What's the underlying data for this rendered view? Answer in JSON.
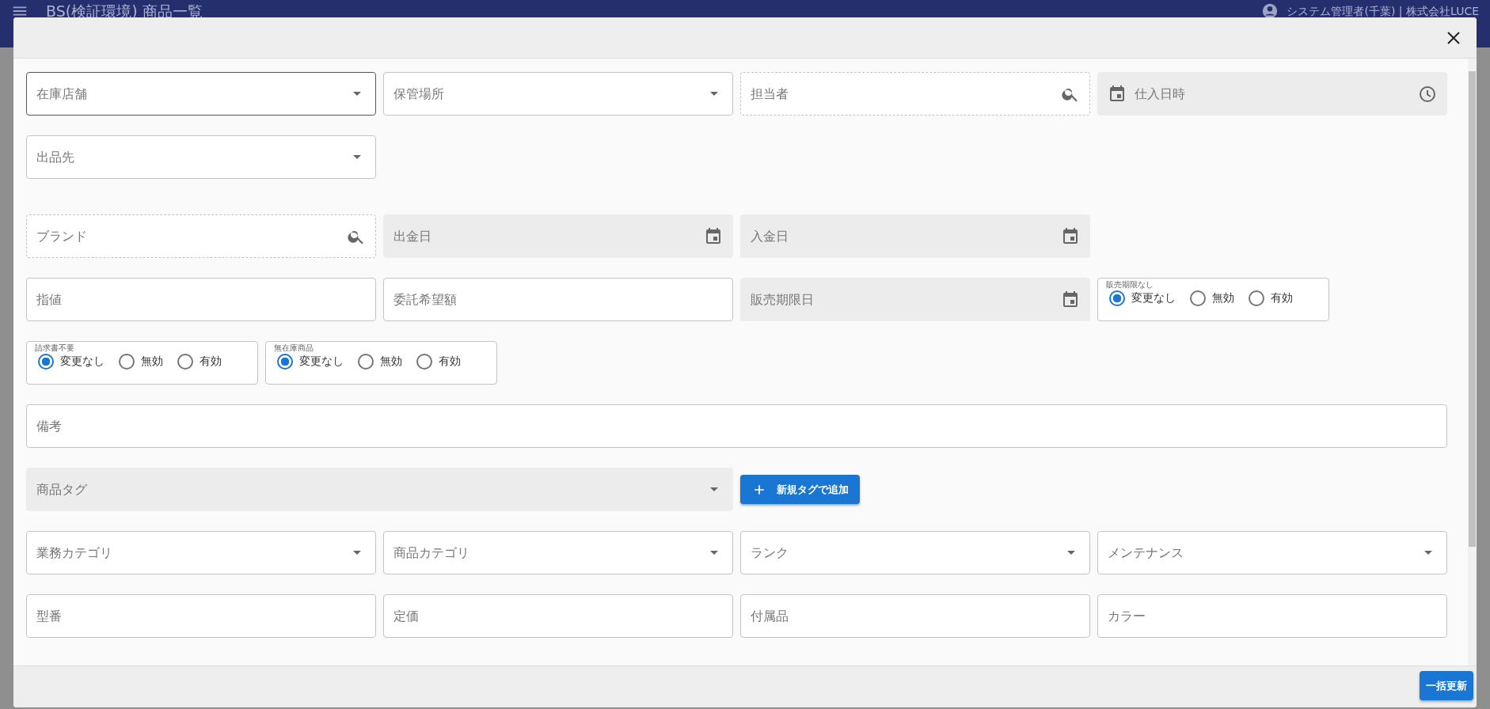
{
  "app_bar": {
    "title": "BS(検証環境) 商品一覧",
    "user": "システム管理者(千葉) | 株式会社LUCE"
  },
  "dialog": {
    "rows": [
      {
        "items": [
          {
            "kind": "select",
            "placeholder": "在庫店舗",
            "focused": true
          },
          {
            "kind": "select",
            "placeholder": "保管場所",
            "focused": false
          },
          {
            "kind": "search",
            "placeholder": "担当者"
          },
          {
            "kind": "datetime",
            "placeholder": "仕入日時"
          }
        ]
      },
      {
        "items": [
          {
            "kind": "select",
            "placeholder": "出品先",
            "focused": false
          }
        ]
      },
      {
        "items": [
          {
            "kind": "search",
            "placeholder": "ブランド"
          },
          {
            "kind": "date",
            "placeholder": "出金日"
          },
          {
            "kind": "date",
            "placeholder": "入金日"
          }
        ]
      },
      {
        "items": [
          {
            "kind": "text",
            "placeholder": "指値"
          },
          {
            "kind": "text",
            "placeholder": "委託希望額"
          },
          {
            "kind": "date",
            "placeholder": "販売期限日"
          },
          {
            "kind": "radio",
            "label": "販売期限なし",
            "options": [
              {
                "label": "変更なし",
                "selected": true
              },
              {
                "label": "無効",
                "selected": false
              },
              {
                "label": "有効",
                "selected": false
              }
            ]
          }
        ]
      },
      {
        "items": [
          {
            "kind": "radio",
            "label": "請求書不要",
            "options": [
              {
                "label": "変更なし",
                "selected": true
              },
              {
                "label": "無効",
                "selected": false
              },
              {
                "label": "有効",
                "selected": false
              }
            ]
          },
          {
            "kind": "radio",
            "label": "無在庫商品",
            "options": [
              {
                "label": "変更なし",
                "selected": true
              },
              {
                "label": "無効",
                "selected": false
              },
              {
                "label": "有効",
                "selected": false
              }
            ]
          }
        ]
      },
      {
        "items": [
          {
            "kind": "wide",
            "placeholder": "備考"
          }
        ]
      },
      {
        "items": [
          {
            "kind": "tags",
            "placeholder": "商品タグ",
            "button": "新規タグで追加"
          }
        ]
      },
      {
        "items": [
          {
            "kind": "select",
            "placeholder": "業務カテゴリ",
            "focused": false
          },
          {
            "kind": "select",
            "placeholder": "商品カテゴリ",
            "focused": false
          },
          {
            "kind": "select",
            "placeholder": "ランク",
            "focused": false
          },
          {
            "kind": "select",
            "placeholder": "メンテナンス",
            "focused": false
          }
        ]
      },
      {
        "items": [
          {
            "kind": "text",
            "placeholder": "型番"
          },
          {
            "kind": "text",
            "placeholder": "定価"
          },
          {
            "kind": "text",
            "placeholder": "付属品"
          },
          {
            "kind": "text",
            "placeholder": "カラー"
          }
        ]
      }
    ],
    "footer_button": "一括更新"
  }
}
